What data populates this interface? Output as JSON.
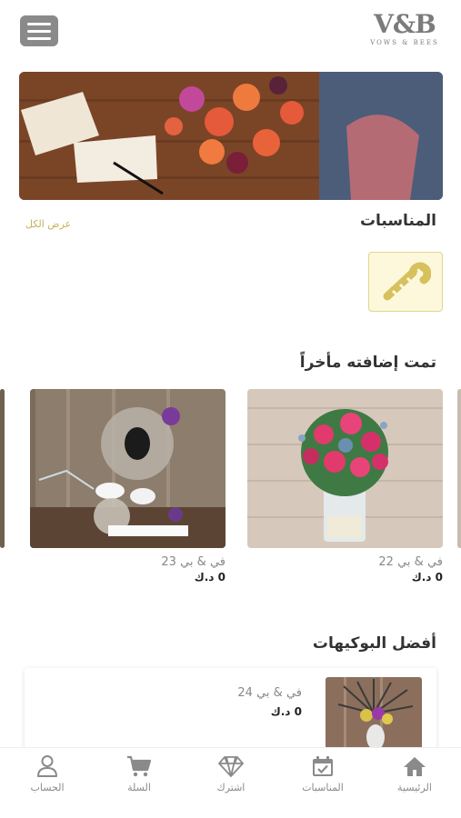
{
  "brand": {
    "mark": "V&B",
    "sub": "VOWS & BEES"
  },
  "occasions": {
    "title": "المناسبات",
    "see_all": "عرض الكل",
    "items": [
      {
        "icon": "candy-cane-icon"
      }
    ]
  },
  "recent": {
    "title": "تمت إضافته مأخراً",
    "products": [
      {
        "name": "في & بي 22",
        "price": "0 د.ك"
      },
      {
        "name": "في & بي 23",
        "price": "0 د.ك"
      }
    ]
  },
  "best": {
    "title": "أفضل البوكيهات",
    "products": [
      {
        "name": "في & بي 24",
        "price": "0 د.ك"
      }
    ]
  },
  "nav": [
    {
      "label": "الرئيسية",
      "icon": "home-icon"
    },
    {
      "label": "المناسبات",
      "icon": "calendar-icon"
    },
    {
      "label": "اشترك",
      "icon": "diamond-icon"
    },
    {
      "label": "السلة",
      "icon": "cart-icon"
    },
    {
      "label": "الحساب",
      "icon": "user-icon"
    }
  ],
  "colors": {
    "accent": "#c8b25a",
    "tile_bg": "#fdf8dc",
    "icon_gray": "#8a8a8a"
  }
}
